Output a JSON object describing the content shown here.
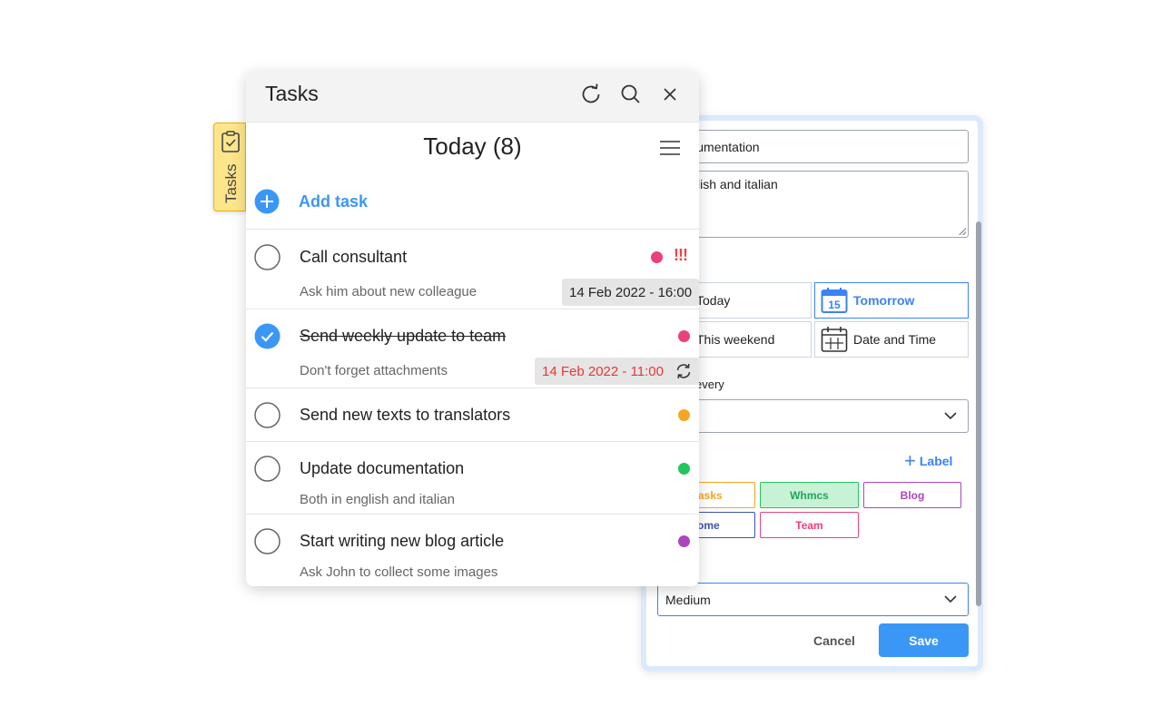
{
  "tasks_popup": {
    "title": "Tasks",
    "day_heading": "Today (8)",
    "add_task_label": "Add task",
    "tasks": [
      {
        "title": "Call consultant",
        "description": "Ask him about new colleague",
        "completed": false,
        "color": "#ec407a",
        "priority_mark": "!!!",
        "due": "14 Feb 2022 - 16:00"
      },
      {
        "title": "Send weekly update to team",
        "description": "Don't forget attachments",
        "completed": true,
        "color": "#ec407a",
        "due": "14 Feb 2022 - 11:00",
        "due_color": "#e53935"
      },
      {
        "title": "Send new texts to translators",
        "completed": false,
        "color": "#f5a623"
      },
      {
        "title": "Update documentation",
        "description": "Both in english and italian",
        "completed": false,
        "color": "#22c55e"
      },
      {
        "title": "Start writing new blog article",
        "description": "Ask John to collect some images",
        "completed": false,
        "color": "#ab47bc"
      }
    ]
  },
  "side_tab": {
    "label": "Tasks"
  },
  "edit_panel": {
    "title_value": "e documentation",
    "notes_value": "n english and italian",
    "date_options": [
      {
        "label": "Today",
        "active": false
      },
      {
        "label": "Tomorrow",
        "active": true,
        "calendar_day": "15"
      },
      {
        "label": "This weekend",
        "active": false
      },
      {
        "label": "Date and Time",
        "active": false
      }
    ],
    "repeat_label": "every",
    "repeat_value": "",
    "add_label_button": "Label",
    "labels": [
      {
        "name": "asks",
        "color": "#f5a623",
        "selected": false
      },
      {
        "name": "Whmcs",
        "color": "#22c55e",
        "selected": true
      },
      {
        "name": "Blog",
        "color": "#ab47bc",
        "selected": false
      },
      {
        "name": "ome",
        "color": "#3f51b5",
        "selected": false
      },
      {
        "name": "Team",
        "color": "#ec407a",
        "selected": false
      }
    ],
    "priority_value": "Medium",
    "cancel_label": "Cancel",
    "save_label": "Save"
  },
  "colors": {
    "accent": "#3b97f6",
    "danger": "#e53935",
    "tab_yellow": "#fde68a"
  }
}
